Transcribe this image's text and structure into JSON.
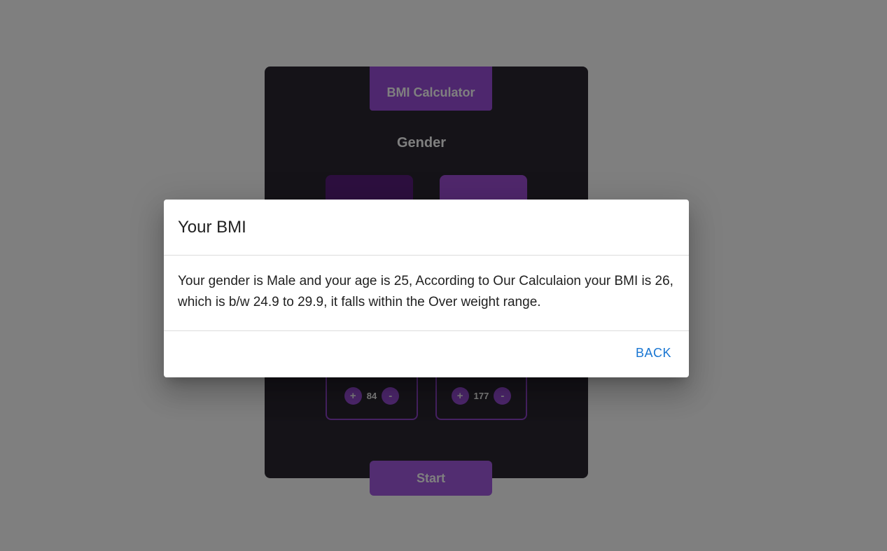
{
  "app": {
    "title": "BMI Calculator",
    "gender_heading": "Gender",
    "weight_stepper": {
      "increment": "+",
      "value": "84",
      "decrement": "-"
    },
    "height_stepper": {
      "increment": "+",
      "value": "177",
      "decrement": "-"
    },
    "start_label": "Start"
  },
  "dialog": {
    "title": "Your BMI",
    "message": "Your gender is Male and your age is 25, According to Our Calculaion your BMI is 26, which is b/w 24.9 to 29.9, it falls within the Over weight range.",
    "back_label": "BACK"
  },
  "colors": {
    "accent": "#9d4edd",
    "card_bg": "#2a2730",
    "link": "#1976d2"
  }
}
